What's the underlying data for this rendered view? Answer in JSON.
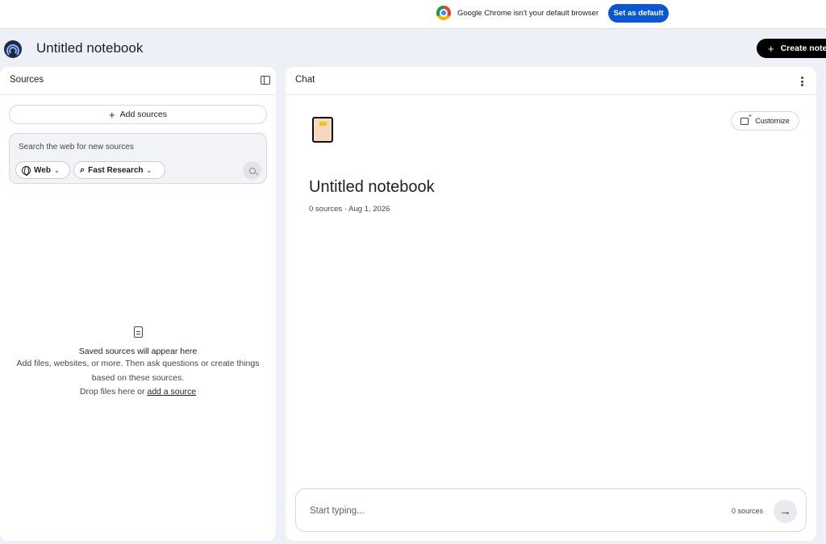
{
  "infobar": {
    "message": "Google Chrome isn't your default browser",
    "button_label": "Set as default"
  },
  "header": {
    "title": "Untitled notebook",
    "create_label": "Create note"
  },
  "sources": {
    "title": "Sources",
    "add_label": "Add sources",
    "search_placeholder": "Search the web for new sources",
    "web_chip": "Web",
    "research_chip": "Fast Research",
    "empty_title": "Saved sources will appear here",
    "empty_line1": "Add files, websites, or more. Then ask questions or create things based on these sources.",
    "empty_line2_prefix": "Drop files here or ",
    "empty_link": "add a source"
  },
  "chat": {
    "title": "Chat",
    "customize_label": "Customize",
    "notebook_title": "Untitled notebook",
    "meta": "0 sources · Aug 1, 2026",
    "input_placeholder": "Start typing...",
    "source_count": "0 sources"
  },
  "icons": {
    "app_logo": "notebooklm-logo",
    "send": "arrow-right-icon",
    "toggle": "panel-toggle-icon"
  },
  "colors": {
    "accent": "#0b57d0",
    "page_bg": "#eef0f8",
    "create_btn": "#000000"
  }
}
